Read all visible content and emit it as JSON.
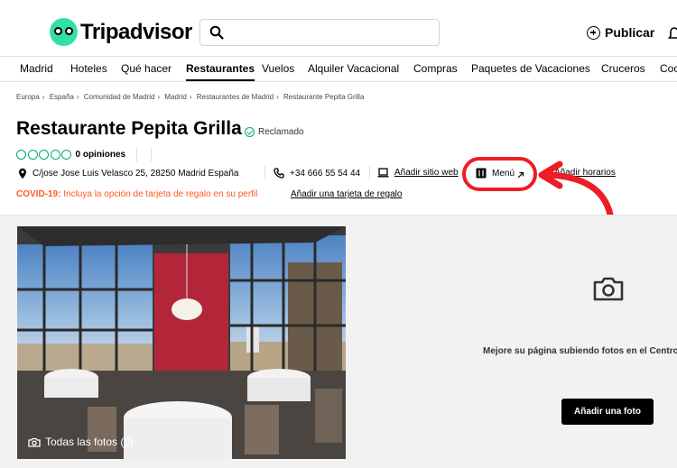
{
  "header": {
    "logo_text": "Tripadvisor",
    "search": {
      "placeholder": ""
    },
    "publish_label": "Publicar"
  },
  "nav": {
    "items": [
      "Madrid",
      "Hoteles",
      "Qué hacer",
      "Restaurantes",
      "Vuelos",
      "Alquiler Vacacional",
      "Compras",
      "Paquetes de Vacaciones",
      "Cruceros",
      "Coc"
    ],
    "active": "Restaurantes"
  },
  "breadcrumb": [
    "Europa",
    "España",
    "Comunidad de Madrid",
    "Madrid",
    "Restaurantes de Madrid",
    "Restaurante Pepita Grilla"
  ],
  "restaurant": {
    "name": "Restaurante Pepita Grilla",
    "claimed_label": "Reclamado",
    "rating_bubbles": 0,
    "reviews_label": "0 opiniones",
    "address": "C/jose Jose Luis Velasco 25, 28250 Madrid España",
    "phone": "+34 666 55 54 44",
    "website_label": "Añadir sitio web",
    "menu_label": "Menú",
    "hours_label": "Añadir horarios",
    "covid_label": "COVID-19:",
    "covid_text": " Incluya la opción de tarjeta de regalo en su perfil",
    "gift_card_label": "Añadir una tarjeta de regalo"
  },
  "gallery": {
    "all_photos_label": "Todas las fotos (0)",
    "upload_message": "Mejore su página subiendo fotos en el Centro",
    "add_photo_label": "Añadir una foto"
  },
  "colors": {
    "brand_green": "#34e0a1",
    "rating_green": "#00aa6c",
    "covid_orange": "#ff5a1f",
    "annotation_red": "#ee1c24"
  }
}
